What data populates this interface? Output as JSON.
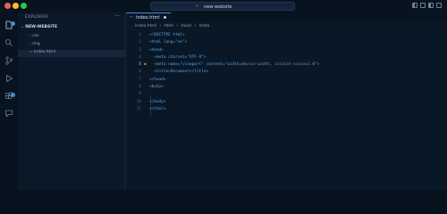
{
  "window": {
    "title": "new-website",
    "colors": {
      "close": "#f25f57",
      "minimize": "#f8bd2e",
      "maximize": "#2dc840",
      "accent": "#3c8dde"
    }
  },
  "sidebar": {
    "title": "EXPLORER",
    "more": "···",
    "folder": "NEW-WEBSITE",
    "items": [
      "css",
      "img",
      "index.html"
    ]
  },
  "editor": {
    "tab": {
      "label": "index.html",
      "icon": "html-icon"
    },
    "breadcrumb": [
      "index.html",
      "html",
      "head",
      "meta"
    ],
    "line_numbers": [
      "1",
      "2",
      "3",
      "4",
      "5",
      "6",
      "7",
      "8",
      "9",
      "10",
      "11"
    ],
    "lines": [
      "<!DOCTYPE html>",
      "<html lang=\"en\">",
      "<head>",
      "  <meta charset=\"UTF-8\">",
      "  <meta name=\"viewport\" content=\"width=device-width, initial-scale=1.0\">",
      "  <title>Document</title>",
      "</head>",
      "<body>",
      "",
      "</body>",
      "</html>"
    ]
  }
}
